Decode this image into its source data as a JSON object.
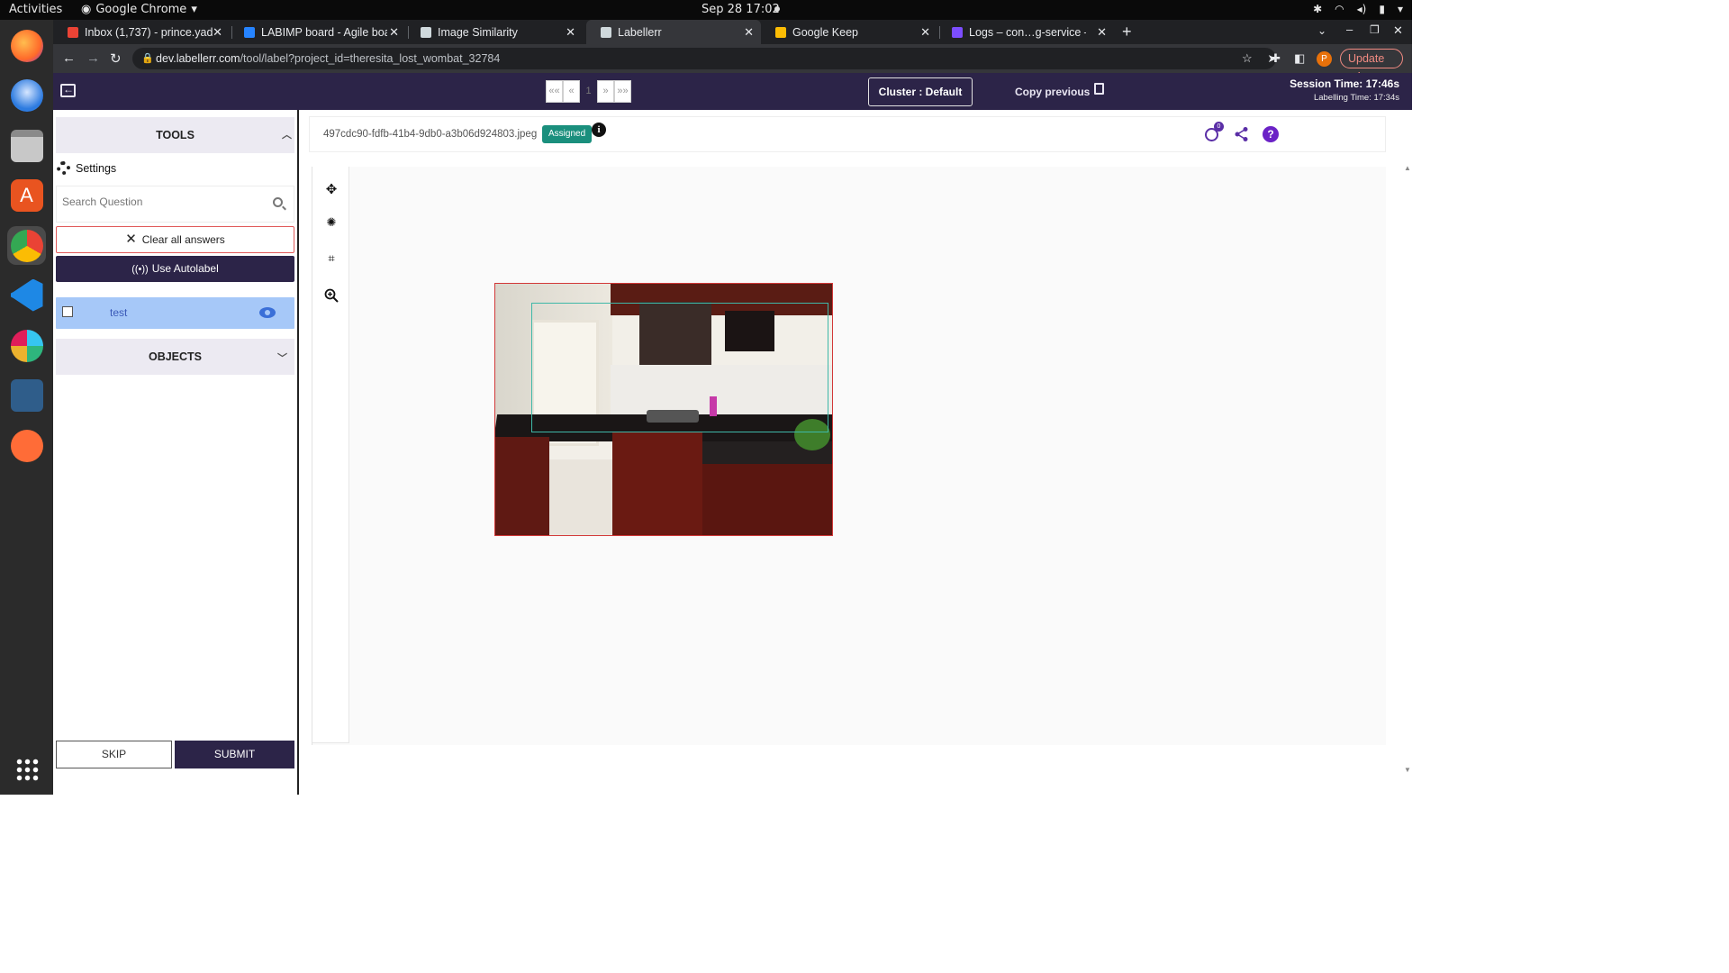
{
  "system": {
    "activities": "Activities",
    "app_menu": "Google Chrome",
    "clock": "Sep 28  17:02"
  },
  "browser": {
    "tabs": [
      {
        "title": "Inbox (1,737) - prince.yad",
        "favicon_color": "#ea4335"
      },
      {
        "title": "LABIMP board - Agile boa",
        "favicon_color": "#2684ff"
      },
      {
        "title": "Image Similarity",
        "favicon_color": "#cfd8dc"
      },
      {
        "title": "Labellerr",
        "favicon_color": "#cfd8dc"
      },
      {
        "title": "Google Keep",
        "favicon_color": "#fbbc04"
      },
      {
        "title": "Logs – con…g-service – C",
        "favicon_color": "#7c4dff"
      }
    ],
    "url_host": "dev.labellerr.com",
    "url_path": "/tool/label?project_id=theresita_lost_wombat_32784",
    "profile_initial": "P",
    "update_label": "Update"
  },
  "app": {
    "pager": [
      "««",
      "«",
      "1",
      "»",
      "»»"
    ],
    "cluster_label": "Cluster : Default",
    "copy_previous_label": "Copy previous",
    "session_time": "Session Time: 17:46s",
    "labelling_time": "Labelling Time: 17:34s"
  },
  "left_panel": {
    "tools_title": "TOOLS",
    "settings_label": "Settings",
    "search_placeholder": "Search Question",
    "clear_label": "Clear all answers",
    "autolabel_label": "Use Autolabel",
    "tool_item": "test",
    "objects_title": "OBJECTS",
    "skip_label": "SKIP",
    "submit_label": "SUBMIT"
  },
  "workspace": {
    "file_name": "497cdc90-fdfb-41b4-9db0-a3b06d924803.jpeg",
    "status_badge": "Assigned",
    "history_count": "0"
  },
  "colors": {
    "brand": "#2c2448",
    "selected_tool": "#a6c8f8",
    "badge": "#1a8f7d",
    "bbox": "#3fb8a8",
    "accent_icon": "#5a2ea6"
  }
}
